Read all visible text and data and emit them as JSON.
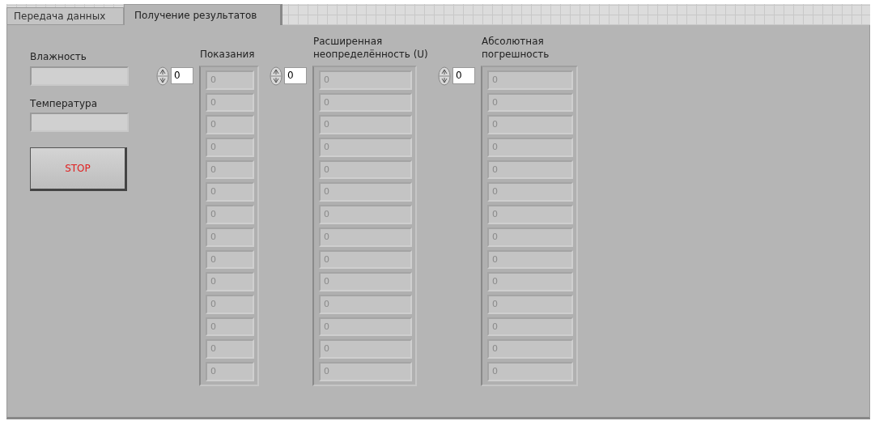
{
  "tabs": [
    {
      "label": "Передача данных",
      "selected": false
    },
    {
      "label": "Получение результатов",
      "selected": true
    }
  ],
  "indicators": [
    {
      "label": "Влажность"
    },
    {
      "label": "Температура"
    }
  ],
  "stop_button": {
    "label": "STOP"
  },
  "arrays": [
    {
      "label": "Показания",
      "index": "0",
      "elements": [
        "0",
        "0",
        "0",
        "0",
        "0",
        "0",
        "0",
        "0",
        "0",
        "0",
        "0",
        "0",
        "0",
        "0"
      ]
    },
    {
      "label": "Расширенная неопределённость (U)",
      "index": "0",
      "elements": [
        "0",
        "0",
        "0",
        "0",
        "0",
        "0",
        "0",
        "0",
        "0",
        "0",
        "0",
        "0",
        "0",
        "0"
      ]
    },
    {
      "label": "Абсолютная погрешность",
      "index": "0",
      "elements": [
        "0",
        "0",
        "0",
        "0",
        "0",
        "0",
        "0",
        "0",
        "0",
        "0",
        "0",
        "0",
        "0",
        "0"
      ]
    }
  ]
}
